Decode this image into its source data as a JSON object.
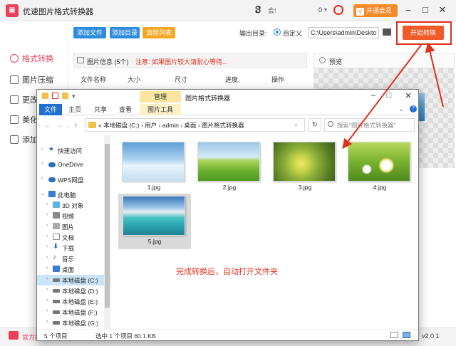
{
  "app": {
    "title": "优速图片格式转换器",
    "user_name": "会!",
    "coin_count": "0",
    "vip_label": "开通会员",
    "vip_icon_char": "V",
    "sidebar_items": [
      "格式转换",
      "图片压缩",
      "更改",
      "美化",
      "添加"
    ],
    "toolbar": {
      "add_file": "添加文件",
      "add_dir": "添加目录",
      "clear_list": "清除列表"
    },
    "output": {
      "label": "输出目录:",
      "option": "自定义",
      "path": "C:\\Users\\admin\\Deskto"
    },
    "start_button": "开始转换",
    "info": {
      "title": "图片信息 (5个)",
      "note": "注意: 如果图片较大请耐心等待..."
    },
    "preview_title": "预览",
    "table_columns": [
      "文件名称",
      "大小",
      "尺寸",
      "进度",
      "操作"
    ],
    "footer": {
      "site": "官方网",
      "version": "v2.0.1"
    },
    "colors": {
      "brand": "#e8405a",
      "start": "#f05a28",
      "arrow": "#e0301e",
      "blue": "#2f8bdd"
    }
  },
  "explorer": {
    "title": "图片格式转换器",
    "manage_tab": "管理",
    "ribbon_tabs": [
      "文件",
      "主页",
      "共享",
      "查看",
      "图片工具"
    ],
    "address_text": "«  本地磁盘 (C:)  ›  用户  ›  admin  ›  桌面  ›  图片格式转换器",
    "search_placeholder": "搜索\"图片格式转换器\"",
    "nav_items": [
      {
        "label": "快速访问",
        "icon": "star-icon"
      },
      {
        "label": "OneDrive",
        "icon": "cloud-icon"
      },
      {
        "label": "WPS网盘",
        "icon": "cloud-icon"
      },
      {
        "label": "此电脑",
        "icon": "pc-icon"
      },
      {
        "label": "3D 对象",
        "icon": "cube-icon"
      },
      {
        "label": "视频",
        "icon": "video-icon"
      },
      {
        "label": "图片",
        "icon": "picture-icon"
      },
      {
        "label": "文档",
        "icon": "document-icon"
      },
      {
        "label": "下载",
        "icon": "download-icon"
      },
      {
        "label": "音乐",
        "icon": "music-icon"
      },
      {
        "label": "桌面",
        "icon": "desktop-icon"
      },
      {
        "label": "本地磁盘 (C:)",
        "icon": "drive-icon"
      },
      {
        "label": "本地磁盘 (D:)",
        "icon": "drive-icon"
      },
      {
        "label": "本地磁盘 (E:)",
        "icon": "drive-icon"
      },
      {
        "label": "本地磁盘 (F:)",
        "icon": "drive-icon"
      },
      {
        "label": "本地磁盘 (G:)",
        "icon": "drive-icon"
      }
    ],
    "files": [
      "1.jpg",
      "2.jpg",
      "3.jpg",
      "4.jpg",
      "5.jpg"
    ],
    "status_count": "5 个项目",
    "status_selected": "选中 1 个项目  60.1 KB"
  },
  "annotation": "完成转换后，自动打开文件夹"
}
